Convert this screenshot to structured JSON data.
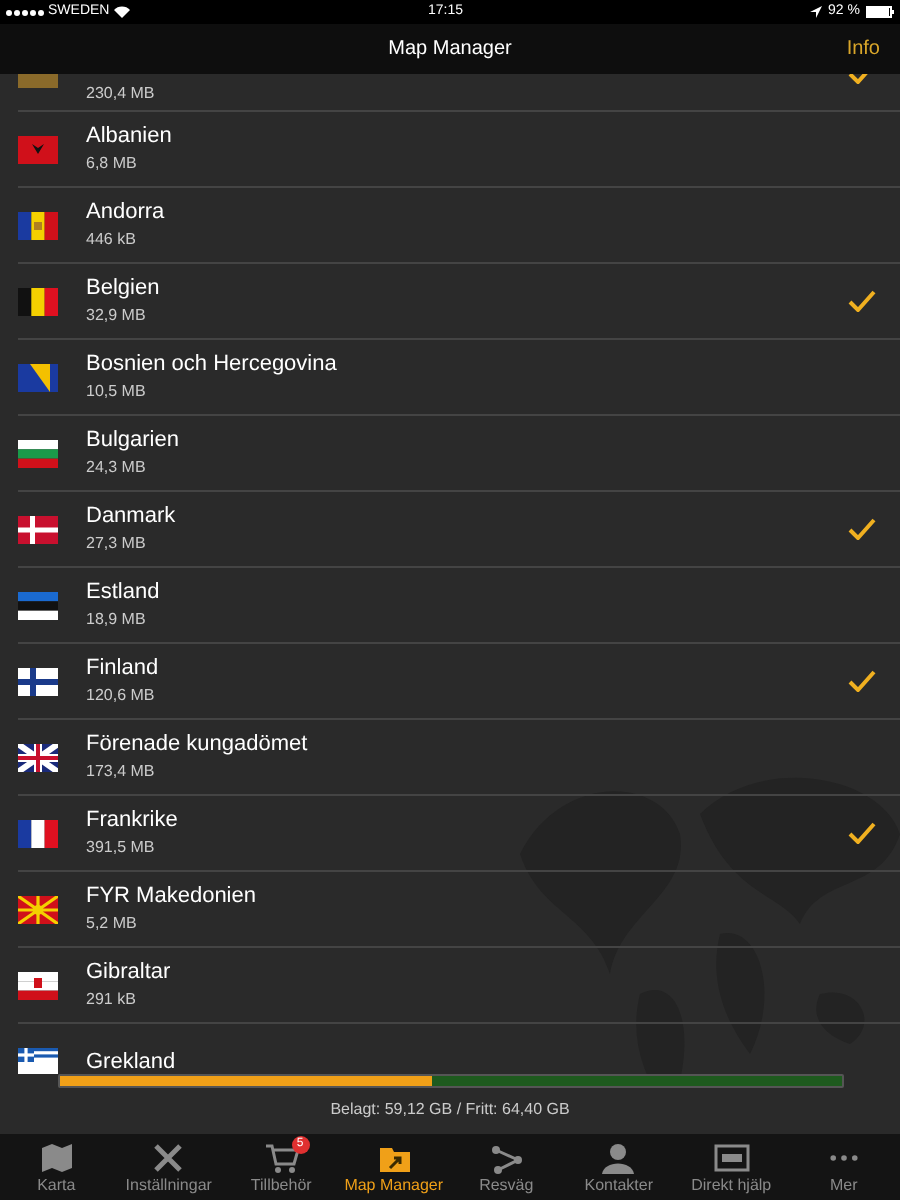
{
  "status_bar": {
    "carrier": "SWEDEN",
    "time": "17:15",
    "battery": "92 %"
  },
  "nav_bar": {
    "title": "Map Manager",
    "right_button": "Info"
  },
  "maps": [
    {
      "size": "230,4 MB",
      "checked": true
    },
    {
      "name": "Albanien",
      "size": "6,8 MB",
      "checked": false
    },
    {
      "name": "Andorra",
      "size": "446 kB",
      "checked": false
    },
    {
      "name": "Belgien",
      "size": "32,9 MB",
      "checked": true
    },
    {
      "name": "Bosnien och Hercegovina",
      "size": "10,5 MB",
      "checked": false
    },
    {
      "name": "Bulgarien",
      "size": "24,3 MB",
      "checked": false
    },
    {
      "name": "Danmark",
      "size": "27,3 MB",
      "checked": true
    },
    {
      "name": "Estland",
      "size": "18,9 MB",
      "checked": false
    },
    {
      "name": "Finland",
      "size": "120,6 MB",
      "checked": true
    },
    {
      "name": "Förenade kungadömet",
      "size": "173,4 MB",
      "checked": false
    },
    {
      "name": "Frankrike",
      "size": "391,5 MB",
      "checked": true
    },
    {
      "name": "FYR Makedonien",
      "size": "5,2 MB",
      "checked": false
    },
    {
      "name": "Gibraltar",
      "size": "291 kB",
      "checked": false
    },
    {
      "name": "Grekland",
      "checked": false
    }
  ],
  "storage": {
    "level": 0.478,
    "text": "Belagt: 59,12 GB / Fritt: 64,40 GB"
  },
  "tab_bar": [
    {
      "label": "Karta",
      "selected": false
    },
    {
      "label": "Inställningar",
      "selected": false
    },
    {
      "label": "Tillbehör",
      "selected": false,
      "badge": "5"
    },
    {
      "label": "Map Manager",
      "selected": true
    },
    {
      "label": "Resväg",
      "selected": false
    },
    {
      "label": "Kontakter",
      "selected": false
    },
    {
      "label": "Direkt hjälp",
      "selected": false
    },
    {
      "label": "Mer",
      "selected": false
    }
  ]
}
